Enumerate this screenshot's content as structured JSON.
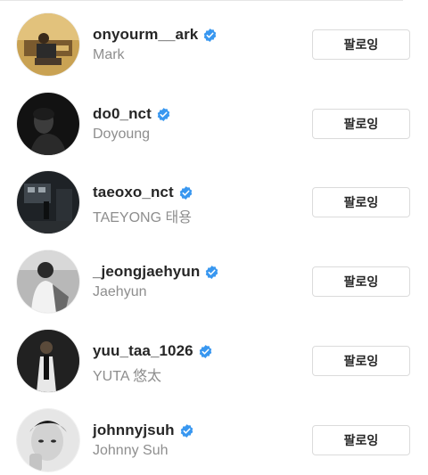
{
  "following": [
    {
      "username": "onyourm__ark",
      "full_name": "Mark",
      "verified": true,
      "button_label": "팔로잉"
    },
    {
      "username": "do0_nct",
      "full_name": "Doyoung",
      "verified": true,
      "button_label": "팔로잉"
    },
    {
      "username": "taeoxo_nct",
      "full_name": "TAEYONG 태용",
      "verified": true,
      "button_label": "팔로잉"
    },
    {
      "username": "_jeongjaehyun",
      "full_name": "Jaehyun",
      "verified": true,
      "button_label": "팔로잉"
    },
    {
      "username": "yuu_taa_1026",
      "full_name": "YUTA 悠太",
      "verified": true,
      "button_label": "팔로잉"
    },
    {
      "username": "johnnyjsuh",
      "full_name": "Johnny Suh",
      "verified": true,
      "button_label": "팔로잉"
    }
  ],
  "colors": {
    "verified_badge": "#3897f0",
    "username_text": "#262626",
    "secondary_text": "#8e8e8e",
    "button_border": "#dbdbdb"
  }
}
